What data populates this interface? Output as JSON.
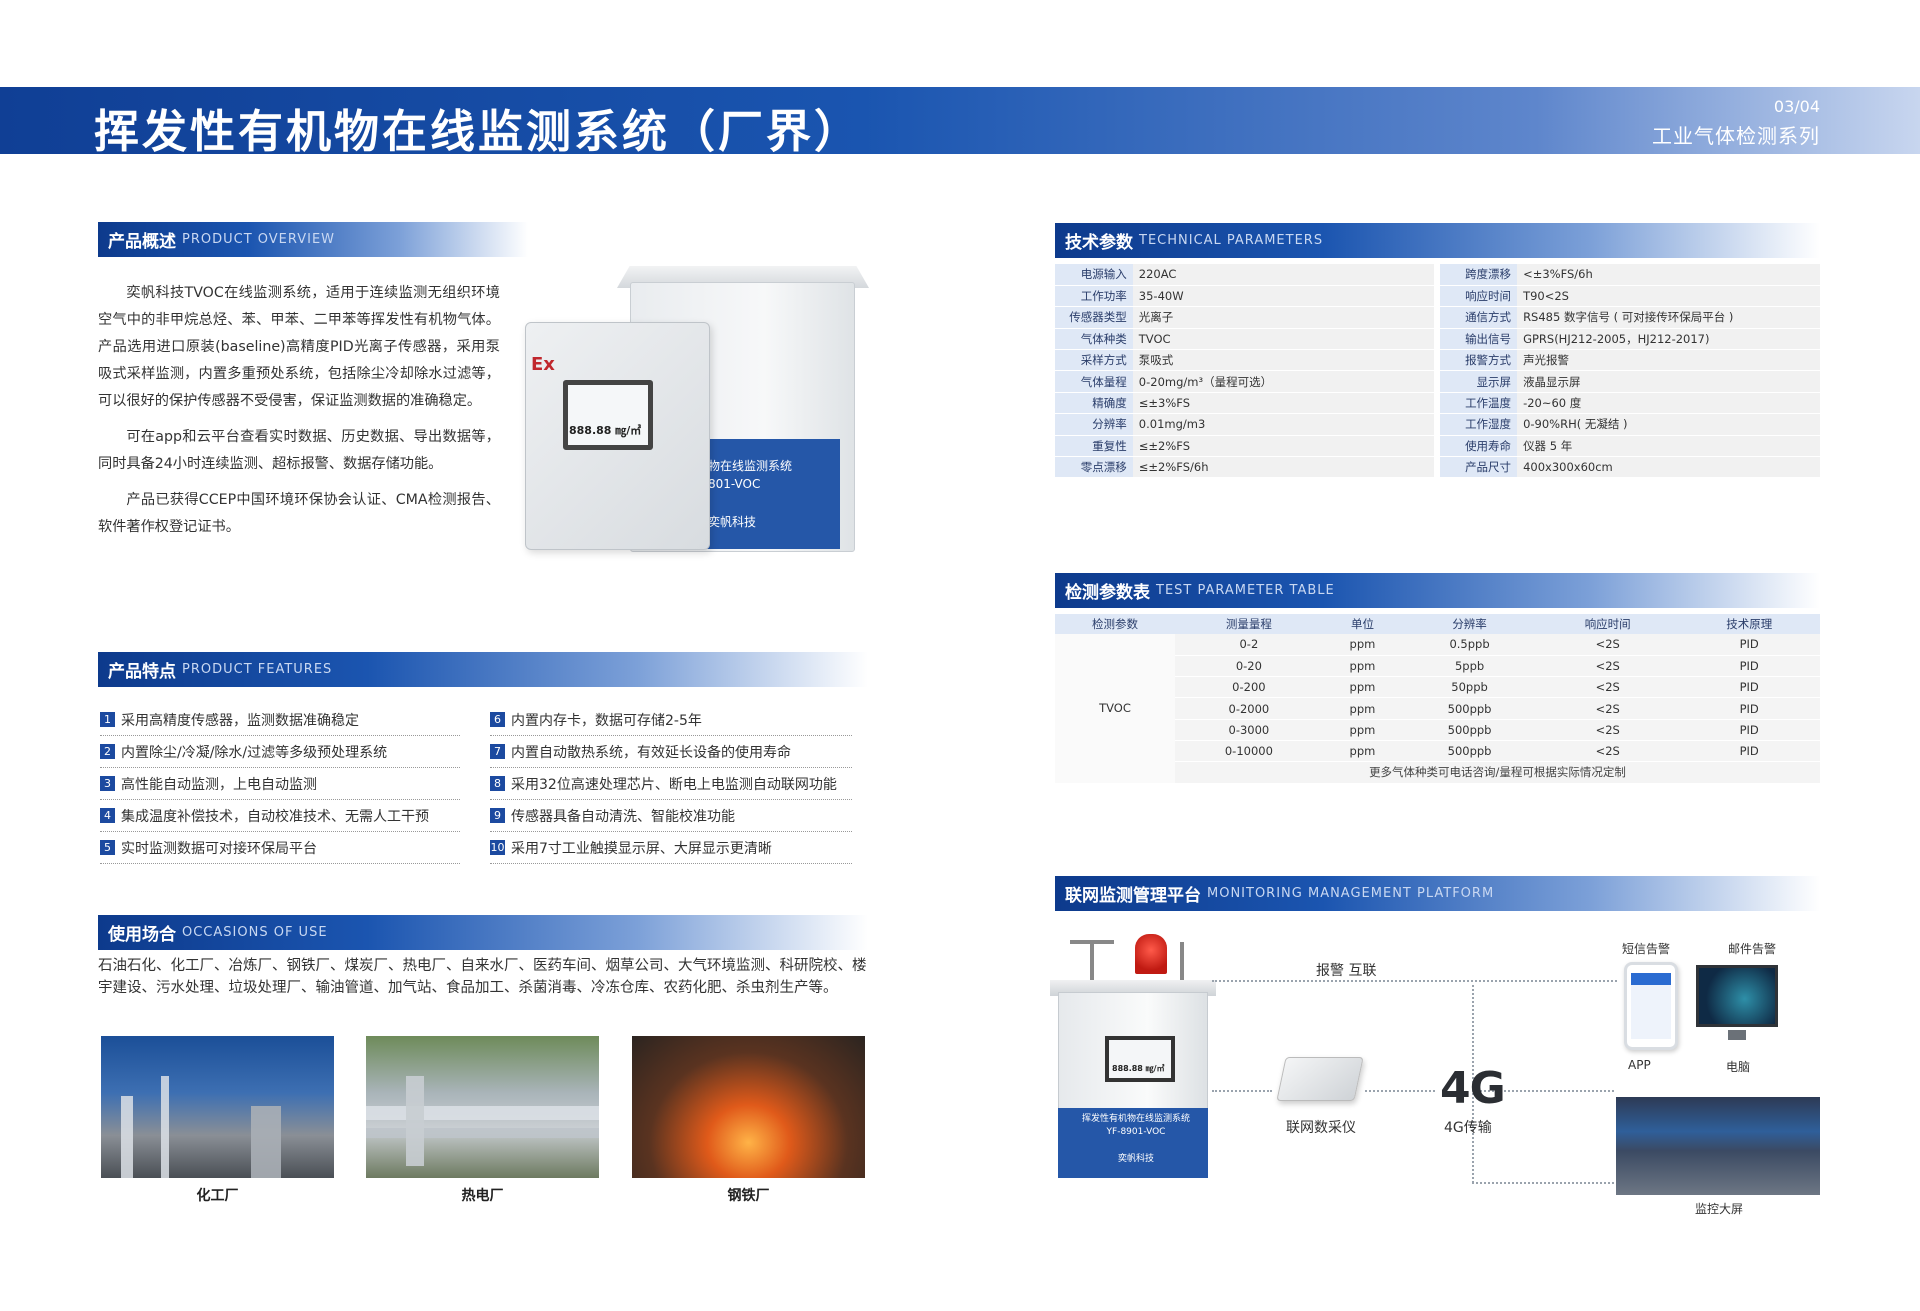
{
  "header": {
    "title": "挥发性有机物在线监测系统（厂界）",
    "page": "03/04",
    "series": "工业气体检测系列"
  },
  "sections": {
    "overview": {
      "cn": "产品概述",
      "en": "PRODUCT OVERVIEW"
    },
    "features": {
      "cn": "产品特点",
      "en": "PRODUCT FEATURES"
    },
    "occasions": {
      "cn": "使用场合",
      "en": "OCCASIONS OF USE"
    },
    "tech": {
      "cn": "技术参数",
      "en": "TECHNICAL PARAMETERS"
    },
    "test": {
      "cn": "检测参数表",
      "en": "TEST PARAMETER TABLE"
    },
    "platform": {
      "cn": "联网监测管理平台",
      "en": "MONITORING MANAGEMENT PLATFORM"
    }
  },
  "overview": {
    "p1": "奕帆科技TVOC在线监测系统，适用于连续监测无组织环境空气中的非甲烷总烃、苯、甲苯、二甲苯等挥发性有机物气体。产品选用进口原装(baseline)高精度PID光离子传感器，采用泵吸式采样监测，内置多重预处系统，包括除尘冷却除水过滤等，可以很好的保护传感器不受侵害，保证监测数据的准确稳定。",
    "p2": "可在app和云平台查看实时数据、历史数据、导出数据等，同时具备24小时连续监测、超标报警、数据存储功能。",
    "p3": "产品已获得CCEP中国环境环保协会认证、CMA检测报告、软件著作权登记证书。"
  },
  "device": {
    "ex_label": "Ex",
    "reading": "888.88 ㎎/㎥",
    "panel_line1": "物在线监测系统",
    "panel_line2": "801-VOC",
    "brand": "奕帆科技"
  },
  "features": {
    "left": [
      {
        "n": "1",
        "text": "采用高精度传感器，监测数据准确稳定"
      },
      {
        "n": "2",
        "text": "内置除尘/冷凝/除水/过滤等多级预处理系统"
      },
      {
        "n": "3",
        "text": "高性能自动监测，上电自动监测"
      },
      {
        "n": "4",
        "text": "集成温度补偿技术，自动校准技术、无需人工干预"
      },
      {
        "n": "5",
        "text": "实时监测数据可对接环保局平台"
      }
    ],
    "right": [
      {
        "n": "6",
        "text": "内置内存卡，数据可存储2-5年"
      },
      {
        "n": "7",
        "text": "内置自动散热系统，有效延长设备的使用寿命"
      },
      {
        "n": "8",
        "text": "采用32位高速处理芯片、断电上电监测自动联网功能"
      },
      {
        "n": "9",
        "text": "传感器具备自动清洗、智能校准功能"
      },
      {
        "n": "10",
        "text": "采用7寸工业触摸显示屏、大屏显示更清晰"
      }
    ]
  },
  "occasions": {
    "text": "石油石化、化工厂、冶炼厂、钢铁厂、煤炭厂、热电厂、自来水厂、医药车间、烟草公司、大气环境监测、科研院校、楼宇建设、污水处理、垃圾处理厂、输油管道、加气站、食品加工、杀菌消毒、冷冻仓库、农药化肥、杀虫剂生产等。",
    "photos": [
      "化工厂",
      "热电厂",
      "钢铁厂"
    ]
  },
  "tech_params": [
    {
      "k1": "电源输入",
      "v1": "220AC",
      "k2": "跨度漂移",
      "v2": "<±3%FS/6h"
    },
    {
      "k1": "工作功率",
      "v1": "35-40W",
      "k2": "响应时间",
      "v2": "T90<2S"
    },
    {
      "k1": "传感器类型",
      "v1": "光离子",
      "k2": "通信方式",
      "v2": "RS485 数字信号 ( 可对接传环保局平台 )"
    },
    {
      "k1": "气体种类",
      "v1": "TVOC",
      "k2": "输出信号",
      "v2": "GPRS(HJ212-2005，HJ212-2017)"
    },
    {
      "k1": "采样方式",
      "v1": "泵吸式",
      "k2": "报警方式",
      "v2": "声光报警"
    },
    {
      "k1": "气体量程",
      "v1": "0-20mg/m³（量程可选）",
      "k2": "显示屏",
      "v2": "液晶显示屏"
    },
    {
      "k1": "精确度",
      "v1": "≤±3%FS",
      "k2": "工作温度",
      "v2": "-20~60 度"
    },
    {
      "k1": "分辨率",
      "v1": "0.01mg/m3",
      "k2": "工作湿度",
      "v2": "0-90%RH( 无凝结 )"
    },
    {
      "k1": "重复性",
      "v1": "≤±2%FS",
      "k2": "使用寿命",
      "v2": "仪器 5 年"
    },
    {
      "k1": "零点漂移",
      "v1": "≤±2%FS/6h",
      "k2": "产品尺寸",
      "v2": "400x300x60cm"
    }
  ],
  "test_table": {
    "headers": [
      "检测参数",
      "测量量程",
      "单位",
      "分辨率",
      "响应时间",
      "技术原理"
    ],
    "param": "TVOC",
    "rows": [
      [
        "0-2",
        "ppm",
        "0.5ppb",
        "<2S",
        "PID"
      ],
      [
        "0-20",
        "ppm",
        "5ppb",
        "<2S",
        "PID"
      ],
      [
        "0-200",
        "ppm",
        "50ppb",
        "<2S",
        "PID"
      ],
      [
        "0-2000",
        "ppm",
        "500ppb",
        "<2S",
        "PID"
      ],
      [
        "0-3000",
        "ppm",
        "500ppb",
        "<2S",
        "PID"
      ],
      [
        "0-10000",
        "ppm",
        "500ppb",
        "<2S",
        "PID"
      ]
    ],
    "note": "更多气体种类可电话咨询/量程可根据实际情况定制"
  },
  "platform": {
    "alarm_link": "报警 互联",
    "collector": "联网数采仪",
    "net_big": "4G",
    "net_label": "4G传输",
    "sms": "短信告警",
    "mail": "邮件告警",
    "app": "APP",
    "pc": "电脑",
    "bigscreen": "监控大屏",
    "station_line1": "挥发性有机物在线监测系统",
    "station_line2": "YF-8901-VOC",
    "station_brand": "奕帆科技",
    "station_reading": "888.88 ㎎/㎥"
  },
  "colors": {
    "brand_blue": "#1b55b0",
    "header_blue": "#103f95",
    "table_key": "#dfe8f6"
  }
}
